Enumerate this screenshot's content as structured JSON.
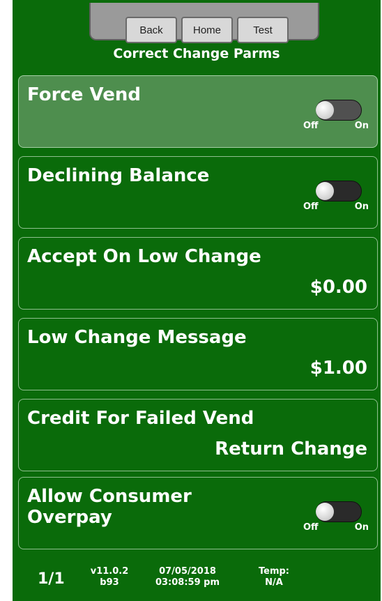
{
  "nav": {
    "back_label": "Back",
    "home_label": "Home",
    "test_label": "Test"
  },
  "screen_title": "Correct Change Parms",
  "rows": [
    {
      "label": "Force Vend",
      "kind": "toggle",
      "state": "off",
      "selected": true
    },
    {
      "label": "Declining Balance",
      "kind": "toggle",
      "state": "off",
      "selected": false
    },
    {
      "label": "Accept On Low Change",
      "kind": "value",
      "value": "$0.00"
    },
    {
      "label": "Low Change Message",
      "kind": "value",
      "value": "$1.00"
    },
    {
      "label": "Credit For Failed Vend",
      "kind": "value",
      "value": "Return Change"
    },
    {
      "label": "Allow Consumer Overpay",
      "kind": "toggle",
      "state": "off",
      "selected": false
    }
  ],
  "toggle_labels": {
    "off": "Off",
    "on": "On"
  },
  "footer": {
    "page": "1/1",
    "version": "v11.0.2",
    "build": "b93",
    "date": "07/05/2018",
    "time": "03:08:59 pm",
    "temp_label": "Temp:",
    "temp_value": "N/A"
  },
  "colors": {
    "background": "#0a6b0a",
    "selected_row": "#4e8e4e",
    "nav_bar": "#9a9a9a"
  }
}
